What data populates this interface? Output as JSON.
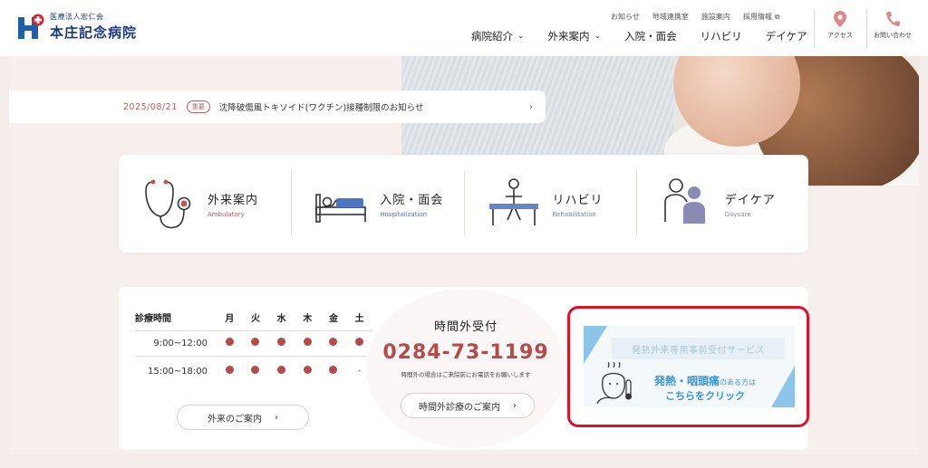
{
  "header": {
    "logo_small": "医療法人宏仁会",
    "logo_big": "本庄記念病院",
    "util_nav": [
      "お知らせ",
      "地域連携室",
      "施設案内",
      "採用情報"
    ],
    "main_nav": [
      {
        "label": "病院紹介",
        "has_dropdown": true
      },
      {
        "label": "外来案内",
        "has_dropdown": true
      },
      {
        "label": "入院・面会",
        "has_dropdown": false
      },
      {
        "label": "リハビリ",
        "has_dropdown": false
      },
      {
        "label": "デイケア",
        "has_dropdown": false
      }
    ],
    "access_label": "アクセス",
    "contact_label": "お問い合わせ"
  },
  "news": {
    "date": "2025/08/21",
    "tag": "重要",
    "title": "沈降破傷風トキソイド(ワクチン)接種制限のお知らせ",
    "arrow": "›"
  },
  "categories": [
    {
      "jp": "外来案内",
      "en": "Ambulatory",
      "icon": "stethoscope-icon",
      "color": "#c0575c"
    },
    {
      "jp": "入院・面会",
      "en": "Hospitalization",
      "icon": "hospital-bed-icon",
      "color": "#4a76c2"
    },
    {
      "jp": "リハビリ",
      "en": "Rehabilitation",
      "icon": "rehabilitation-icon",
      "color": "#6b83c2"
    },
    {
      "jp": "デイケア",
      "en": "Daycare",
      "icon": "daycare-icon",
      "color": "#8a8ab2"
    }
  ],
  "hours": {
    "header_label": "診療時間",
    "days": [
      "月",
      "火",
      "水",
      "木",
      "金",
      "土"
    ],
    "rows": [
      {
        "time": "9:00~12:00",
        "open": [
          true,
          true,
          true,
          true,
          true,
          true
        ]
      },
      {
        "time": "15:00~18:00",
        "open": [
          true,
          true,
          true,
          true,
          true,
          false
        ]
      }
    ],
    "closed_mark": "-",
    "guide_button": "外来のご案内"
  },
  "after_hours": {
    "title": "時間外受付",
    "phone": "0284-73-1199",
    "note": "時間外の場合はご来院前にお電話をお願いします",
    "button": "時間外診療のご案内"
  },
  "fever_banner": {
    "service": "発熱外来専用事前受付サービス",
    "line1_main": "発熱・咽頭痛",
    "line1_small": "のある方は",
    "line2": "こちらをクリック"
  },
  "colors": {
    "accent_red": "#b54a4a",
    "logo_blue": "#1d3b7a",
    "banner_blue": "#3a95d6",
    "highlight_box": "#e0102a"
  }
}
